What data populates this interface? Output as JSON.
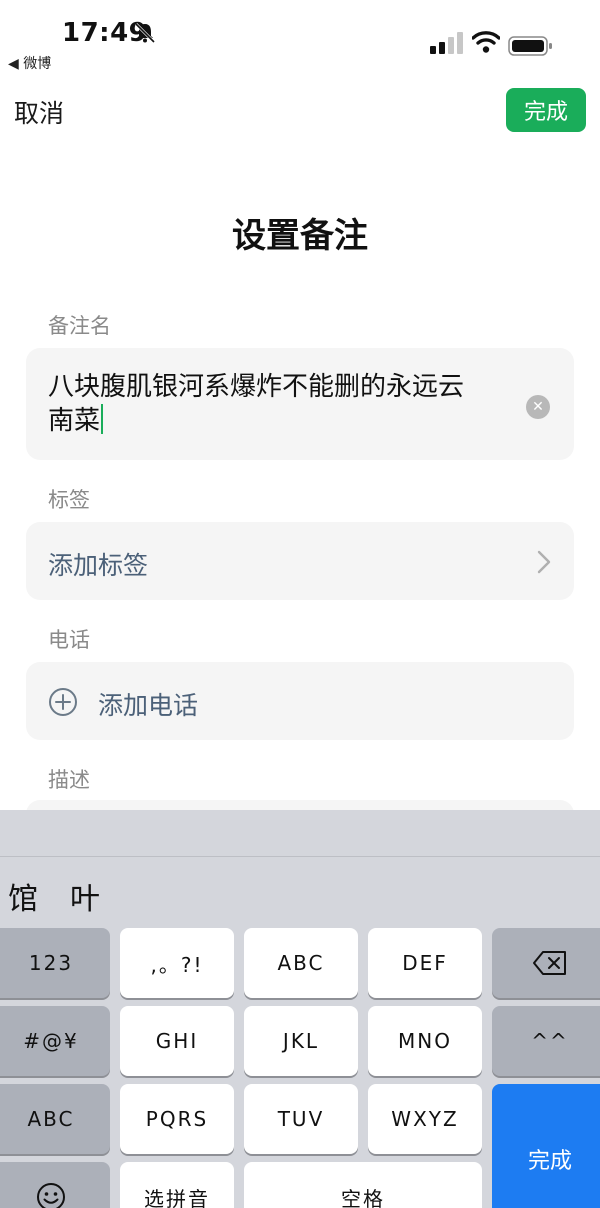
{
  "status_bar": {
    "time": "17:49",
    "back_app": "◀ 微博"
  },
  "nav": {
    "cancel": "取消",
    "done": "完成"
  },
  "page": {
    "title": "设置备注"
  },
  "remark": {
    "label": "备注名",
    "value_line1": "八块腹肌银河系爆炸不能删的永远云",
    "value_line2": "南菜"
  },
  "tags": {
    "label": "标签",
    "placeholder": "添加标签"
  },
  "phone": {
    "label": "电话",
    "add": "添加电话"
  },
  "description": {
    "label": "描述"
  },
  "keyboard": {
    "candidates": [
      "馆",
      "叶"
    ],
    "keys": {
      "k123": "123",
      "punct": ",。?!",
      "abc": "ABC",
      "def": "DEF",
      "symbols": "#@¥",
      "ghi": "GHI",
      "jkl": "JKL",
      "mno": "MNO",
      "emoticon": "^^",
      "abc_switch": "ABC",
      "pqrs": "PQRS",
      "tuv": "TUV",
      "wxyz": "WXYZ",
      "done": "完成",
      "pinyin": "选拼音",
      "space": "空格"
    }
  },
  "colors": {
    "accent_green": "#1aad5a",
    "keyboard_blue": "#1d7cf2",
    "link_gray": "#4b6078"
  }
}
